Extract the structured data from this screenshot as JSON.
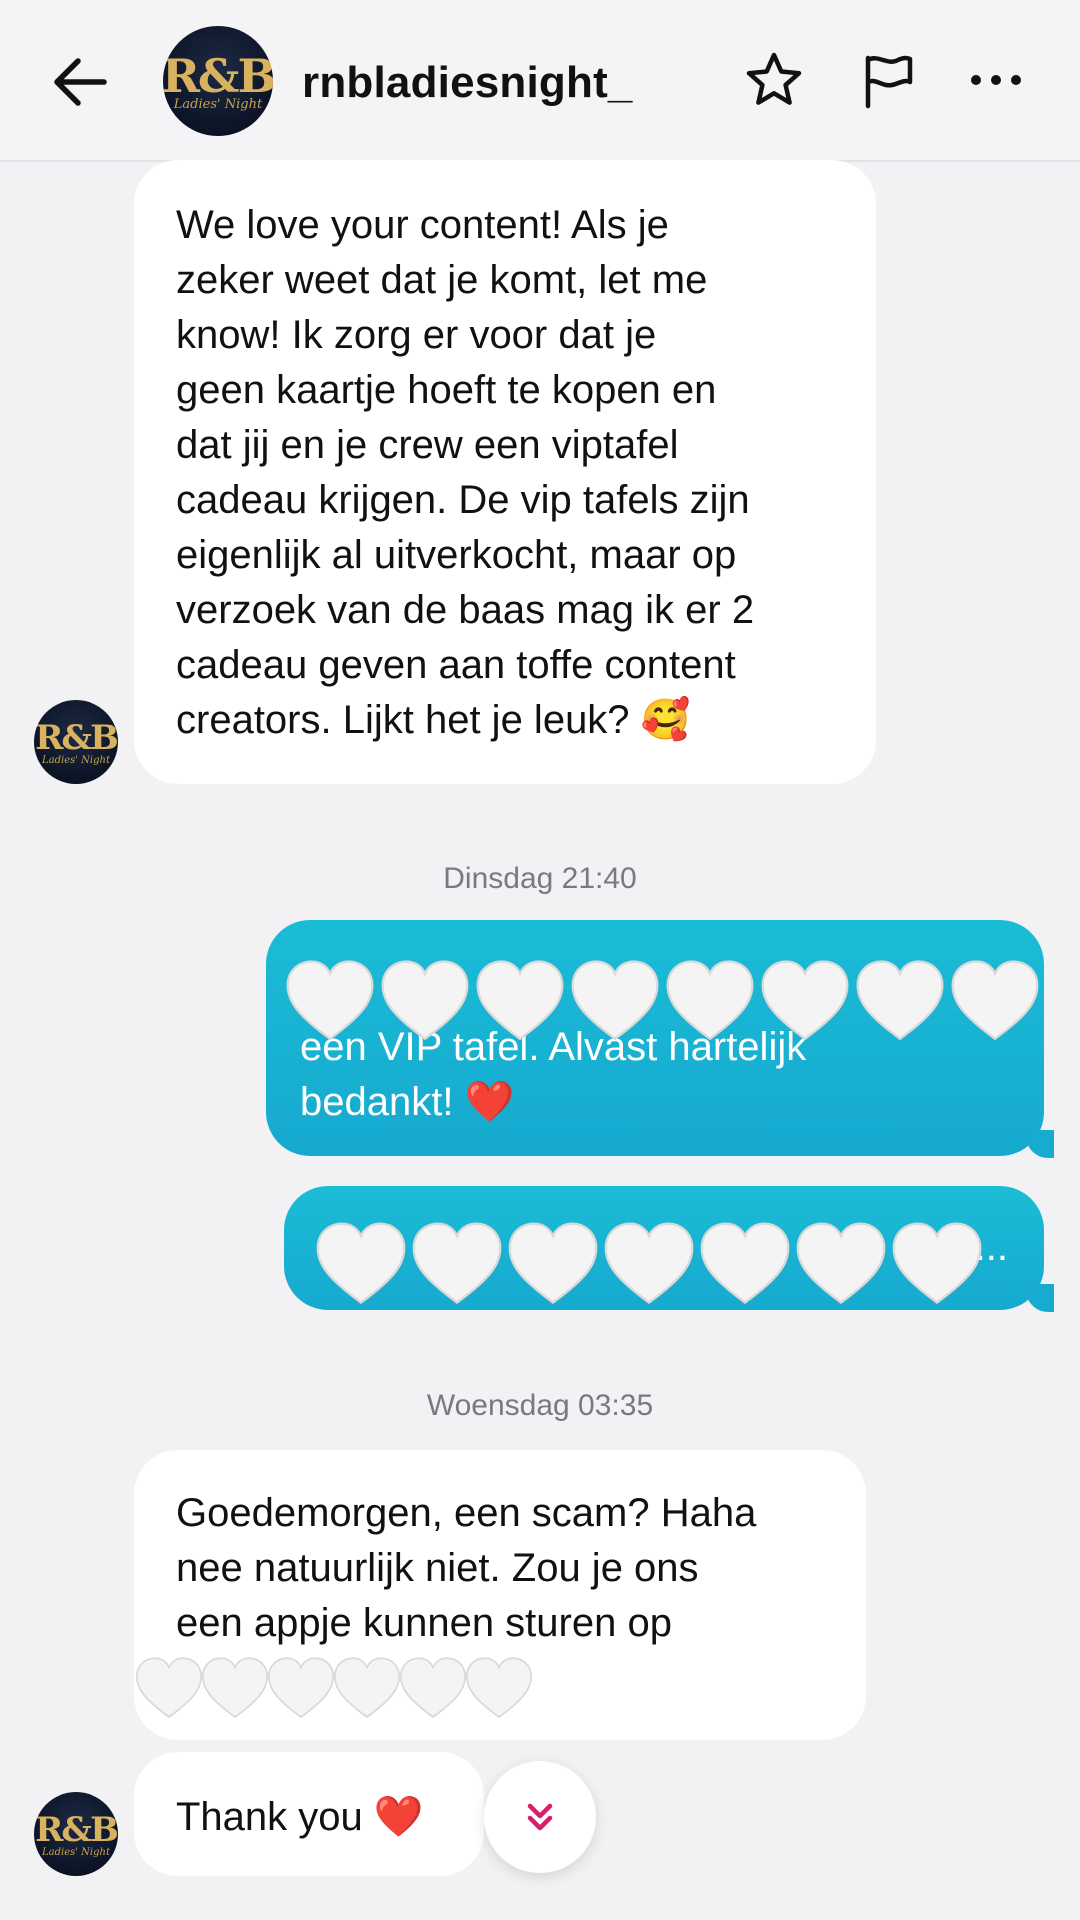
{
  "header": {
    "username": "rnbladiesnight_",
    "avatar_logo": "R&B",
    "avatar_sub": "Ladies' Night"
  },
  "messages": {
    "m1": "We love your content! Als je\nzeker weet dat je komt, let me\nknow! Ik zorg er voor dat je\ngeen kaartje hoeft te kopen en\ndat jij en je crew een viptafel\ncadeau krijgen. De vip tafels zijn\neigenlijk al uitverkocht, maar op\nverzoek van de baas mag ik er 2\ncadeau geven aan toffe content\ncreators. Lijkt het je leuk? 🥰",
    "ts1": "Dinsdag 21:40",
    "m2_visible": "een VIP tafel. Alvast hartelijk\nbedankt! ❤️",
    "m3_visible": "...",
    "ts2": "Woensdag 03:35",
    "m4": "Goedemorgen, een scam? Haha\nnee natuurlijk niet. Zou je ons\neen appje kunnen sturen op",
    "m5": "Thank you ❤️"
  },
  "icons": {
    "back": "arrow-left-icon",
    "star": "star-icon",
    "flag": "flag-icon",
    "more": "more-dots-icon",
    "scroll": "chevron-double-down-icon",
    "redaction": "white-heart-icon"
  },
  "colors": {
    "outgoing_bubble": "#17abd0",
    "incoming_bubble": "#ffffff",
    "background": "#f2f2f4",
    "scroll_chevron": "#d61e6a"
  }
}
